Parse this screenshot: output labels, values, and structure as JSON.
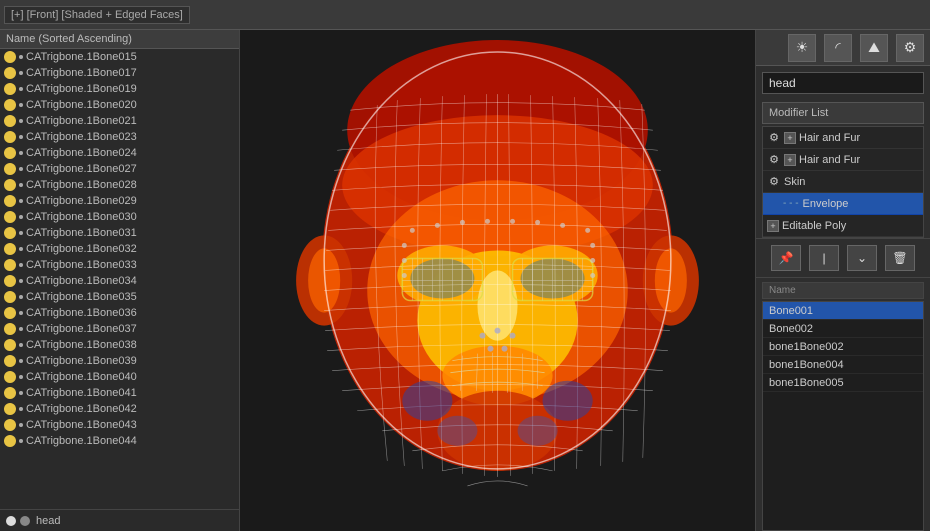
{
  "toolbar": {
    "label": "[+] [Front] [Shaded + Edged Faces]"
  },
  "left_panel": {
    "header": "Name (Sorted Ascending)",
    "items": [
      "CATrigbone.1Bone015",
      "CATrigbone.1Bone017",
      "CATrigbone.1Bone019",
      "CATrigbone.1Bone020",
      "CATrigbone.1Bone021",
      "CATrigbone.1Bone023",
      "CATrigbone.1Bone024",
      "CATrigbone.1Bone027",
      "CATrigbone.1Bone028",
      "CATrigbone.1Bone029",
      "CATrigbone.1Bone030",
      "CATrigbone.1Bone031",
      "CATrigbone.1Bone032",
      "CATrigbone.1Bone033",
      "CATrigbone.1Bone034",
      "CATrigbone.1Bone035",
      "CATrigbone.1Bone036",
      "CATrigbone.1Bone037",
      "CATrigbone.1Bone038",
      "CATrigbone.1Bone039",
      "CATrigbone.1Bone040",
      "CATrigbone.1Bone041",
      "CATrigbone.1Bone042",
      "CATrigbone.1Bone043",
      "CATrigbone.1Bone044"
    ],
    "status_name": "head"
  },
  "right_panel": {
    "object_name": "head",
    "modifier_list_label": "Modifier List",
    "modifiers": [
      {
        "name": "Hair and Fur",
        "type": "gear_plus",
        "selected": false
      },
      {
        "name": "Hair and Fur",
        "type": "gear_plus",
        "selected": false
      },
      {
        "name": "Skin",
        "type": "gear",
        "selected": false
      },
      {
        "name": "Envelope",
        "type": "sub",
        "selected": true
      },
      {
        "name": "Editable Poly",
        "type": "plus",
        "selected": false
      }
    ],
    "bone_list_header": "Name",
    "bones": [
      {
        "name": "Bone001",
        "selected": true
      },
      {
        "name": "Bone002",
        "selected": false
      },
      {
        "name": "bone1Bone002",
        "selected": false
      },
      {
        "name": "bone1Bone004",
        "selected": false
      },
      {
        "name": "bone1Bone005",
        "selected": false
      }
    ],
    "icons": [
      "☀",
      "◱",
      "⛰",
      "⚙"
    ]
  }
}
